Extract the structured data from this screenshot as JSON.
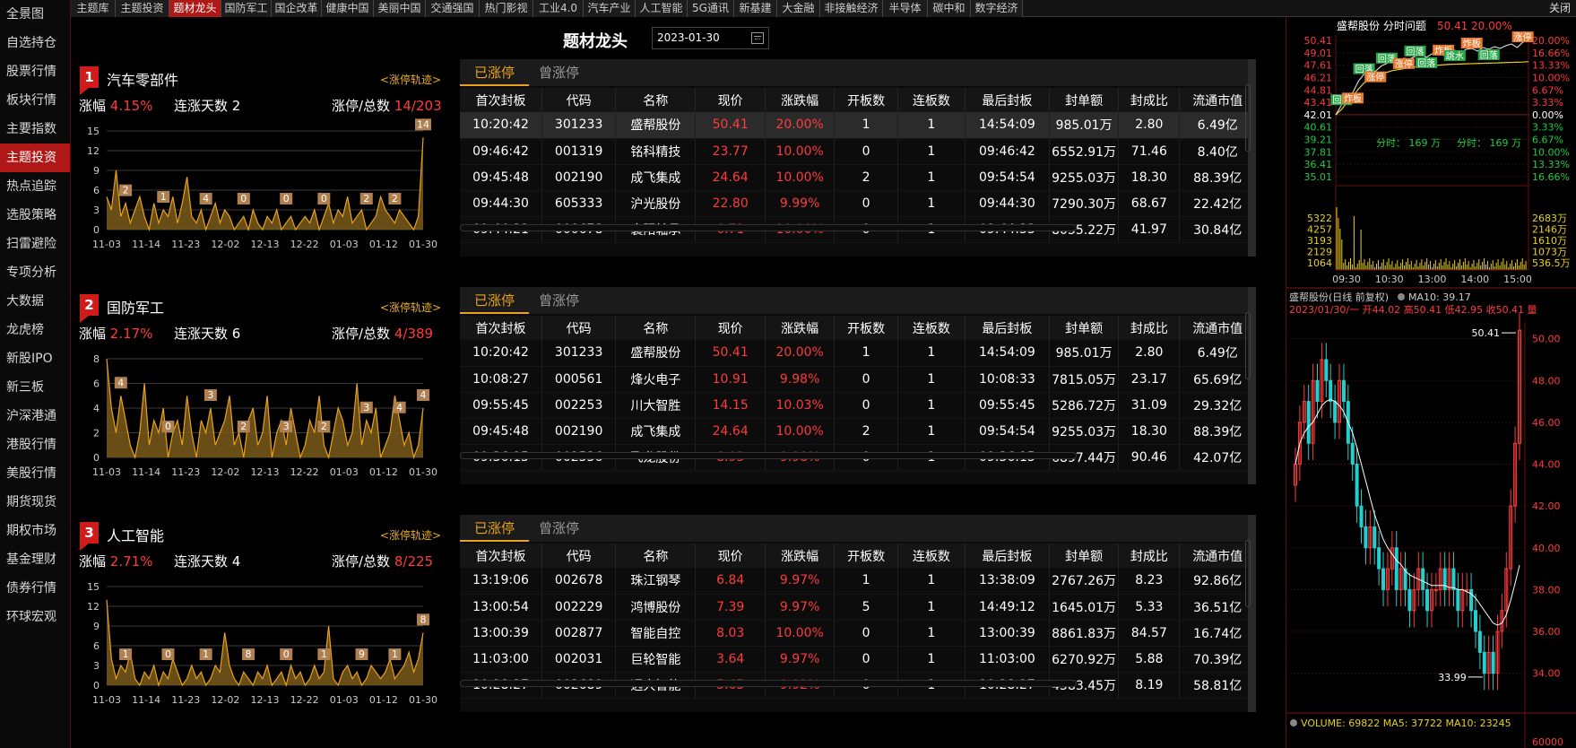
{
  "nav": {
    "items": [
      "全景图",
      "自选持仓",
      "股票行情",
      "板块行情",
      "主要指数",
      "主题投资",
      "热点追踪",
      "选股策略",
      "扫雷避险",
      "专项分析",
      "大数据",
      "龙虎榜",
      "新股IPO",
      "新三板",
      "沪深港通",
      "港股行情",
      "美股行情",
      "期货现货",
      "期权市场",
      "基金理财",
      "债券行情",
      "环球宏观"
    ],
    "active_index": 5
  },
  "tabs": {
    "items": [
      "主题库",
      "主题投资",
      "题材龙头",
      "国防军工",
      "国企改革",
      "健康中国",
      "美丽中国",
      "交通强国",
      "热门影视",
      "工业4.0",
      "汽车产业",
      "人工智能",
      "5G通讯",
      "新基建",
      "大金融",
      "非接触经济",
      "半导体",
      "碳中和",
      "数字经济"
    ],
    "active_index": 2,
    "close_label": "关闭"
  },
  "header": {
    "title": "题材龙头",
    "date": "2023-01-30"
  },
  "labels": {
    "rise": "涨幅",
    "days": "连涨天数",
    "ratio": "涨停/总数",
    "trace": "<涨停轨迹>",
    "tab_done": "已涨停",
    "tab_once": "曾涨停",
    "columns": [
      "首次封板",
      "代码",
      "名称",
      "现价",
      "涨跌幅",
      "开板数",
      "连板数",
      "最后封板",
      "封单额",
      "封成比",
      "流通市值"
    ]
  },
  "themes": [
    {
      "num": "1",
      "name": "汽车零部件",
      "rise": "4.15%",
      "days": "2",
      "ratio": "14/203",
      "chart": {
        "yticks": [
          "15",
          "12",
          "9",
          "6",
          "3",
          "0"
        ],
        "ymax": 15,
        "xticks": [
          "11-03",
          "11-14",
          "11-23",
          "12-02",
          "12-13",
          "12-22",
          "01-03",
          "01-12",
          "01-30"
        ],
        "values": [
          5,
          3,
          9,
          2,
          4,
          1,
          3,
          5,
          2,
          0,
          4,
          1,
          3,
          2,
          5,
          1,
          4,
          8,
          2,
          1,
          3,
          0,
          2,
          4,
          1,
          3,
          2,
          0,
          1,
          2,
          0,
          3,
          1,
          0,
          2,
          1,
          3,
          0,
          1,
          2,
          0,
          1,
          2,
          1,
          3,
          0,
          2,
          4,
          1,
          3,
          2,
          5,
          1,
          2,
          3,
          0,
          1,
          2,
          5,
          3,
          2,
          1,
          3,
          2,
          1,
          0,
          2,
          14
        ],
        "labels": [
          {
            "i": 4,
            "t": "2"
          },
          {
            "i": 12,
            "t": "1"
          },
          {
            "i": 21,
            "t": "4"
          },
          {
            "i": 29,
            "t": "0"
          },
          {
            "i": 38,
            "t": "0"
          },
          {
            "i": 46,
            "t": "0"
          },
          {
            "i": 55,
            "t": "2"
          },
          {
            "i": 61,
            "t": "2"
          },
          {
            "i": 67,
            "t": "14"
          }
        ]
      },
      "rows": [
        [
          "10:20:42",
          "301233",
          "盛帮股份",
          "50.41",
          "20.00%",
          "1",
          "1",
          "14:54:09",
          "985.01万",
          "2.80",
          "6.49亿"
        ],
        [
          "09:46:42",
          "001319",
          "铭科精技",
          "23.77",
          "10.00%",
          "0",
          "1",
          "09:46:42",
          "6552.91万",
          "71.46",
          "8.40亿"
        ],
        [
          "09:45:48",
          "002190",
          "成飞集成",
          "24.64",
          "10.00%",
          "2",
          "1",
          "09:54:54",
          "9255.03万",
          "18.30",
          "88.39亿"
        ],
        [
          "09:44:30",
          "605333",
          "沪光股份",
          "22.80",
          "9.99%",
          "0",
          "1",
          "09:44:30",
          "7290.30万",
          "68.67",
          "22.42亿"
        ],
        [
          "09:44:21",
          "000678",
          "襄阳轴承",
          "6.71",
          "10.00%",
          "0",
          "1",
          "09:44:33",
          "8055.22万",
          "41.97",
          "30.84亿"
        ]
      ],
      "selected_row": 0
    },
    {
      "num": "2",
      "name": "国防军工",
      "rise": "2.17%",
      "days": "6",
      "ratio": "4/389",
      "chart": {
        "yticks": [
          "8",
          "6",
          "4",
          "2",
          "0"
        ],
        "ymax": 8,
        "xticks": [
          "11-03",
          "11-14",
          "11-23",
          "12-02",
          "12-13",
          "12-22",
          "01-03",
          "01-12",
          "01-30"
        ],
        "values": [
          8,
          4,
          2,
          5,
          3,
          1,
          0,
          2,
          6,
          1,
          3,
          2,
          4,
          0,
          2,
          3,
          1,
          5,
          2,
          0,
          3,
          2,
          4,
          1,
          2,
          3,
          5,
          1,
          2,
          0,
          3,
          4,
          1,
          2,
          5,
          0,
          2,
          3,
          1,
          4,
          2,
          0,
          1,
          3,
          2,
          5,
          1,
          0,
          2,
          4,
          3,
          1,
          2,
          6,
          1,
          3,
          2,
          4,
          0,
          1,
          2,
          5,
          3,
          1,
          2,
          0,
          1,
          4
        ],
        "labels": [
          {
            "i": 3,
            "t": "4"
          },
          {
            "i": 13,
            "t": "0"
          },
          {
            "i": 22,
            "t": "3"
          },
          {
            "i": 29,
            "t": "2"
          },
          {
            "i": 38,
            "t": "3"
          },
          {
            "i": 46,
            "t": "2"
          },
          {
            "i": 55,
            "t": "3"
          },
          {
            "i": 62,
            "t": "4"
          },
          {
            "i": 67,
            "t": "4"
          }
        ]
      },
      "rows": [
        [
          "10:20:42",
          "301233",
          "盛帮股份",
          "50.41",
          "20.00%",
          "1",
          "1",
          "14:54:09",
          "985.01万",
          "2.80",
          "6.49亿"
        ],
        [
          "10:08:27",
          "000561",
          "烽火电子",
          "10.91",
          "9.98%",
          "0",
          "1",
          "10:08:33",
          "7815.05万",
          "23.17",
          "65.69亿"
        ],
        [
          "09:55:45",
          "002253",
          "川大智胜",
          "14.15",
          "10.03%",
          "0",
          "1",
          "09:55:45",
          "5286.72万",
          "31.09",
          "29.32亿"
        ],
        [
          "09:45:48",
          "002190",
          "成飞集成",
          "24.64",
          "10.00%",
          "2",
          "1",
          "09:54:54",
          "9255.03万",
          "18.30",
          "88.39亿"
        ],
        [
          "09:36:15",
          "002536",
          "飞龙股份",
          "8.93",
          "9.98%",
          "0",
          "1",
          "09:36:15",
          "6897.44万",
          "90.46",
          "42.07亿"
        ]
      ],
      "selected_row": -1
    },
    {
      "num": "3",
      "name": "人工智能",
      "rise": "2.71%",
      "days": "4",
      "ratio": "8/225",
      "chart": {
        "yticks": [
          "15",
          "12",
          "9",
          "6",
          "3",
          "0"
        ],
        "ymax": 15,
        "xticks": [
          "11-03",
          "11-14",
          "11-23",
          "12-02",
          "12-13",
          "12-22",
          "01-03",
          "01-12",
          "01-30"
        ],
        "values": [
          13,
          4,
          1,
          3,
          2,
          5,
          1,
          0,
          2,
          1,
          3,
          0,
          2,
          1,
          4,
          2,
          0,
          1,
          3,
          1,
          2,
          0,
          1,
          3,
          2,
          8,
          3,
          1,
          0,
          2,
          1,
          0,
          2,
          1,
          3,
          0,
          1,
          2,
          0,
          3,
          1,
          2,
          0,
          1,
          3,
          1,
          2,
          9,
          1,
          0,
          2,
          3,
          1,
          2,
          0,
          1,
          3,
          2,
          1,
          2,
          4,
          1,
          2,
          3,
          5,
          2,
          4,
          8
        ],
        "labels": [
          {
            "i": 4,
            "t": "1"
          },
          {
            "i": 13,
            "t": "0"
          },
          {
            "i": 21,
            "t": "1"
          },
          {
            "i": 30,
            "t": "8"
          },
          {
            "i": 38,
            "t": "0"
          },
          {
            "i": 46,
            "t": "1"
          },
          {
            "i": 54,
            "t": "9"
          },
          {
            "i": 61,
            "t": "1"
          },
          {
            "i": 67,
            "t": "8"
          }
        ]
      },
      "rows": [
        [
          "13:19:06",
          "002678",
          "珠江钢琴",
          "6.84",
          "9.97%",
          "1",
          "1",
          "13:38:09",
          "2767.26万",
          "8.23",
          "92.86亿"
        ],
        [
          "13:00:54",
          "002229",
          "鸿博股份",
          "7.39",
          "9.97%",
          "5",
          "1",
          "14:49:12",
          "1645.01万",
          "5.33",
          "36.51亿"
        ],
        [
          "13:00:39",
          "002877",
          "智能自控",
          "8.03",
          "10.00%",
          "0",
          "1",
          "13:00:39",
          "8861.83万",
          "84.57",
          "16.74亿"
        ],
        [
          "11:03:00",
          "002031",
          "巨轮智能",
          "3.64",
          "9.97%",
          "0",
          "1",
          "11:03:00",
          "6270.92万",
          "5.88",
          "70.39亿"
        ],
        [
          "10:28:27",
          "002689",
          "远大智能",
          "5.65",
          "9.92%",
          "0",
          "1",
          "10:28:27",
          "4583.45万",
          "8.19",
          "58.81亿"
        ]
      ],
      "selected_row": -1
    }
  ],
  "intraday": {
    "title": "盛帮股份  分时问题",
    "last": "50.41",
    "pct": "20.00%",
    "left_ticks": [
      "50.41",
      "49.01",
      "47.61",
      "46.21",
      "44.81",
      "43.41",
      "42.01",
      "40.61",
      "39.21",
      "37.81",
      "36.41",
      "35.01"
    ],
    "right_ticks": [
      "20.00%",
      "16.66%",
      "13.33%",
      "10.00%",
      "6.67%",
      "3.33%",
      "0.00%",
      "3.33%",
      "6.67%",
      "10.00%",
      "13.33%",
      "16.66%"
    ],
    "vol_left": [
      "5322",
      "4257",
      "3193",
      "2129",
      "1064"
    ],
    "vol_right": [
      "2683万",
      "2146万",
      "1610万",
      "1073万",
      "536.5万"
    ],
    "time_ticks": [
      "09:30",
      "10:30",
      "13:00",
      "14:00",
      "15:00"
    ],
    "fenshi_1": "分时：  169 万",
    "fenshi_2": "分时：  169 万",
    "price": [
      42.0,
      43.1,
      43.8,
      44.5,
      45.8,
      46.6,
      47.2,
      46.9,
      47.5,
      47.8,
      48.1,
      48.0,
      48.4,
      48.3,
      48.6,
      48.8,
      48.5,
      48.9,
      49.2,
      48.7,
      48.9,
      49.3,
      49.0,
      49.4,
      49.5,
      49.2,
      49.6,
      49.4,
      49.7,
      49.5,
      49.8,
      50.0,
      49.6,
      50.2,
      50.41
    ],
    "avg": [
      42.0,
      42.6,
      43.4,
      44.1,
      44.9,
      45.6,
      46.0,
      46.3,
      46.6,
      46.8,
      47.0,
      47.1,
      47.2,
      47.3,
      47.4,
      47.45,
      47.5,
      47.55,
      47.6,
      47.65,
      47.7,
      47.72,
      47.74,
      47.76,
      47.78,
      47.8,
      47.82,
      47.84,
      47.86,
      47.88,
      47.9,
      47.92,
      47.94,
      47.96,
      48.0
    ],
    "tags": [
      {
        "i": 1,
        "t": "回落",
        "c": "g"
      },
      {
        "i": 3,
        "t": "炸板",
        "c": "r"
      },
      {
        "i": 5,
        "t": "回落",
        "c": "g"
      },
      {
        "i": 7,
        "t": "涨停",
        "c": "r"
      },
      {
        "i": 9,
        "t": "回落",
        "c": "g"
      },
      {
        "i": 12,
        "t": "涨停",
        "c": "r"
      },
      {
        "i": 14,
        "t": "回落",
        "c": "g"
      },
      {
        "i": 16,
        "t": "回落",
        "c": "g"
      },
      {
        "i": 19,
        "t": "炸板",
        "c": "r"
      },
      {
        "i": 21,
        "t": "跳水",
        "c": "g"
      },
      {
        "i": 24,
        "t": "炸板",
        "c": "r"
      },
      {
        "i": 27,
        "t": "回落",
        "c": "g"
      },
      {
        "i": 33,
        "t": "涨停",
        "c": "r"
      }
    ]
  },
  "daily": {
    "title": "盛帮股份(日线 前复权)",
    "ma10_label": "MA10: 39.17",
    "info": "2023/01/30/一 开44.02 高50.41 低42.95 收50.41 量",
    "high_mark": "50.41",
    "low_mark": "33.99",
    "ticks": [
      "50.00",
      "48.00",
      "46.00",
      "44.00",
      "42.00",
      "40.00",
      "38.00",
      "36.00",
      "34.00"
    ],
    "closes": [
      44,
      46,
      47,
      45,
      48,
      47,
      49,
      48,
      47,
      46,
      48,
      47,
      45,
      44,
      42,
      41,
      40,
      41,
      40,
      39,
      38,
      39,
      40,
      38,
      39,
      38,
      37,
      38,
      39,
      38,
      37,
      38,
      38,
      39,
      38,
      39,
      38,
      37,
      38,
      38,
      37,
      36,
      35,
      34,
      35,
      34,
      36,
      37,
      39,
      42,
      45,
      50.41
    ],
    "ma": [
      44,
      45,
      45.5,
      45.8,
      46,
      46.4,
      46.8,
      47,
      47.1,
      47,
      46.8,
      46.5,
      46,
      45.5,
      44.8,
      44,
      43.2,
      42.4,
      41.6,
      41,
      40.4,
      40,
      39.7,
      39.4,
      39.2,
      38.9,
      38.7,
      38.6,
      38.5,
      38.4,
      38.3,
      38.2,
      38.2,
      38.2,
      38.2,
      38.1,
      38.1,
      38,
      38,
      37.9,
      37.8,
      37.6,
      37.3,
      37,
      36.7,
      36.4,
      36.3,
      36.4,
      36.8,
      37.5,
      38.3,
      39.17
    ],
    "volume_info": "VOLUME: 69822 MA5: 37722 MA10: 23245",
    "vol_tick": "60000"
  },
  "colors": {
    "accent": "#b01717",
    "up": "#ff3b3b",
    "down": "#22cc44",
    "gold": "#e8a21e"
  }
}
